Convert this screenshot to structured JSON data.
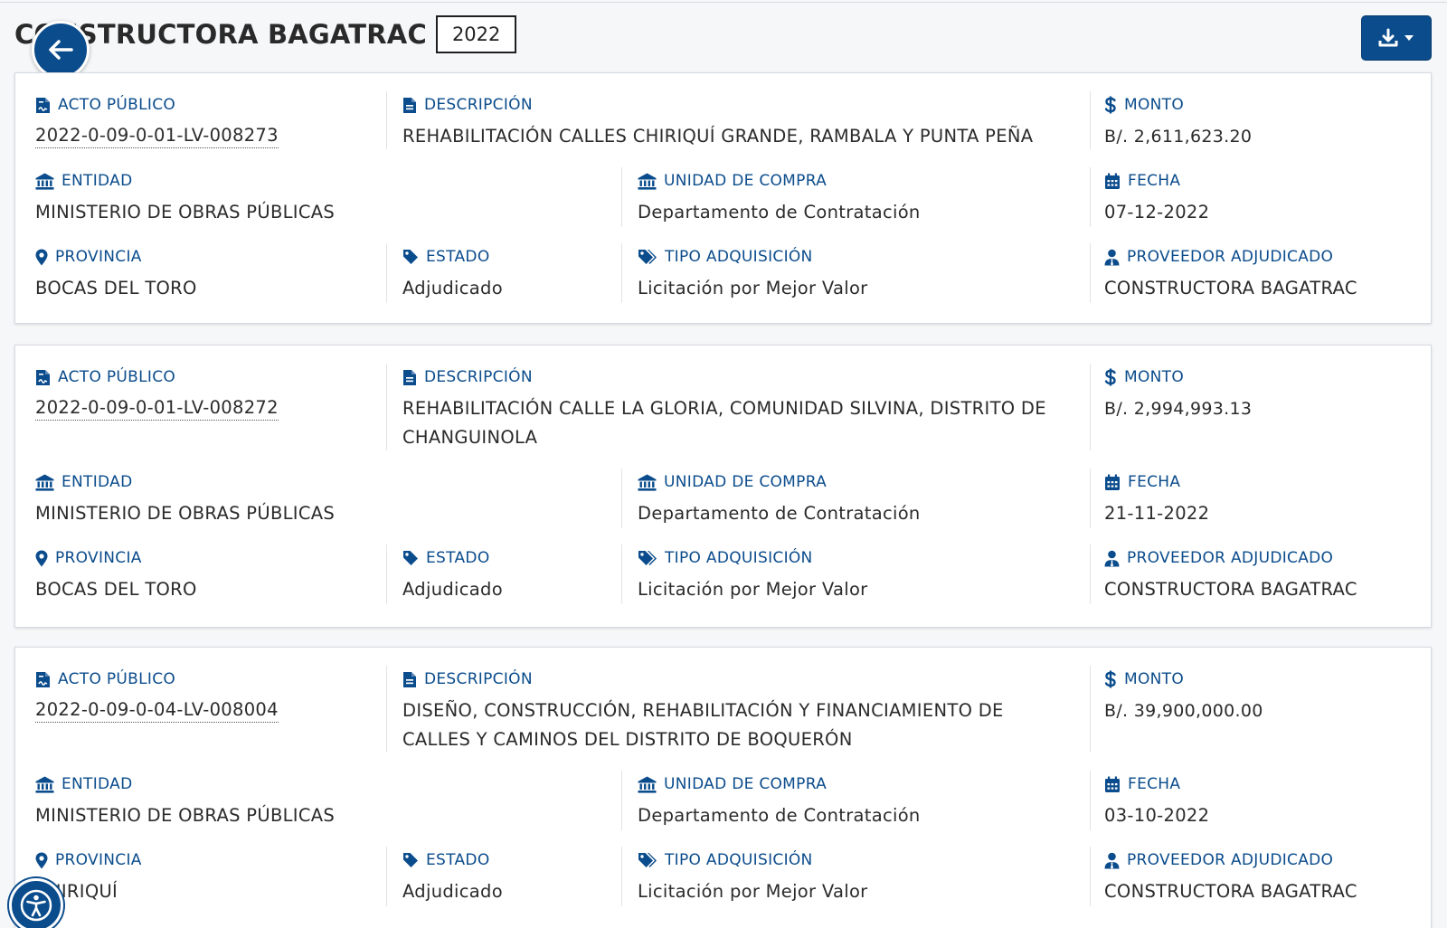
{
  "header": {
    "title": "CONSTRUCTORA BAGATRAC",
    "year": "2022"
  },
  "labels": {
    "acto": "ACTO PÚBLICO",
    "descripcion": "DESCRIPCIÓN",
    "monto": "MONTO",
    "entidad": "ENTIDAD",
    "unidad": "UNIDAD DE COMPRA",
    "fecha": "FECHA",
    "provincia": "PROVINCIA",
    "estado": "ESTADO",
    "tipo": "TIPO ADQUISICIÓN",
    "proveedor": "PROVEEDOR ADJUDICADO"
  },
  "records": [
    {
      "acto": "2022-0-09-0-01-LV-008273",
      "descripcion": "REHABILITACIÓN CALLES CHIRIQUÍ GRANDE, RAMBALA Y PUNTA PEÑA",
      "monto": "B/. 2,611,623.20",
      "entidad": "MINISTERIO DE OBRAS PÚBLICAS",
      "unidad": "Departamento de Contratación",
      "fecha": "07-12-2022",
      "provincia": "BOCAS DEL TORO",
      "estado": "Adjudicado",
      "tipo": "Licitación por Mejor Valor",
      "proveedor": "CONSTRUCTORA BAGATRAC"
    },
    {
      "acto": "2022-0-09-0-01-LV-008272",
      "descripcion": "REHABILITACIÓN CALLE LA GLORIA, COMUNIDAD SILVINA, DISTRITO DE CHANGUINOLA",
      "monto": "B/. 2,994,993.13",
      "entidad": "MINISTERIO DE OBRAS PÚBLICAS",
      "unidad": "Departamento de Contratación",
      "fecha": "21-11-2022",
      "provincia": "BOCAS DEL TORO",
      "estado": "Adjudicado",
      "tipo": "Licitación por Mejor Valor",
      "proveedor": "CONSTRUCTORA BAGATRAC"
    },
    {
      "acto": "2022-0-09-0-04-LV-008004",
      "descripcion": "DISEÑO, CONSTRUCCIÓN, REHABILITACIÓN Y FINANCIAMIENTO DE CALLES Y CAMINOS DEL DISTRITO DE BOQUERÓN",
      "monto": "B/. 39,900,000.00",
      "entidad": "MINISTERIO DE OBRAS PÚBLICAS",
      "unidad": "Departamento de Contratación",
      "fecha": "03-10-2022",
      "provincia": "CHIRIQUÍ",
      "estado": "Adjudicado",
      "tipo": "Licitación por Mejor Valor",
      "proveedor": "CONSTRUCTORA BAGATRAC"
    }
  ],
  "colors": {
    "brand": "#0b4c8c",
    "text": "#2b2b2b",
    "border": "#d6dbe1"
  },
  "icons": {
    "back": "arrow-left-icon",
    "download": "download-icon",
    "acto": "file-contract-icon",
    "descripcion": "file-text-icon",
    "monto": "dollar-icon",
    "entidad": "bank-building-icon",
    "unidad": "bank-building-icon",
    "fecha": "calendar-icon",
    "provincia": "map-pin-icon",
    "estado": "tag-icon",
    "tipo": "tags-icon",
    "proveedor": "user-tie-icon",
    "accessibility": "accessibility-icon"
  }
}
